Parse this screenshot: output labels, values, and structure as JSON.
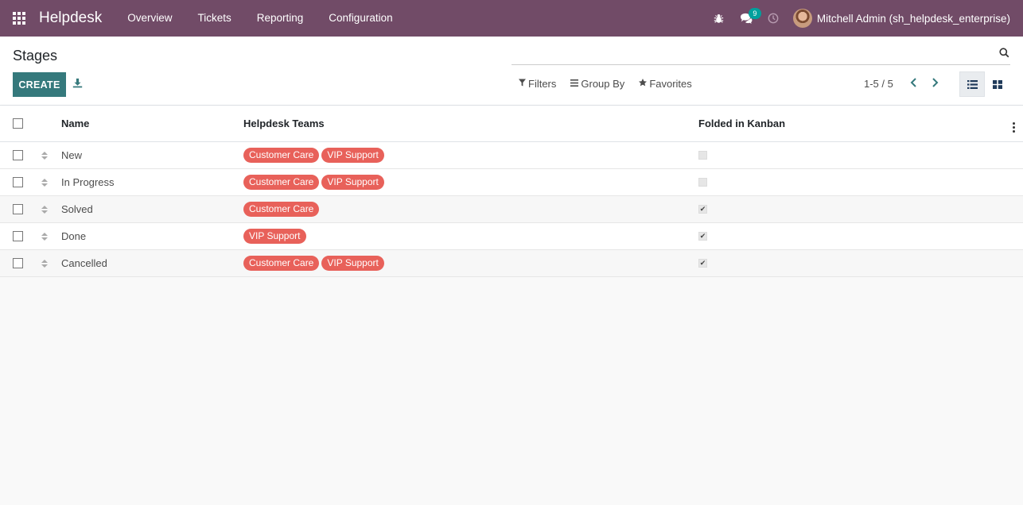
{
  "navbar": {
    "brand": "Helpdesk",
    "menu": [
      "Overview",
      "Tickets",
      "Reporting",
      "Configuration"
    ],
    "messages_count": "9",
    "user": "Mitchell Admin (sh_helpdesk_enterprise)"
  },
  "control_panel": {
    "title": "Stages",
    "search_placeholder": "",
    "create_label": "CREATE",
    "filters_label": "Filters",
    "groupby_label": "Group By",
    "favorites_label": "Favorites",
    "pager": "1-5 / 5"
  },
  "table": {
    "headers": {
      "name": "Name",
      "teams": "Helpdesk Teams",
      "folded": "Folded in Kanban"
    },
    "rows": [
      {
        "name": "New",
        "teams": [
          "Customer Care",
          "VIP Support"
        ],
        "folded": false
      },
      {
        "name": "In Progress",
        "teams": [
          "Customer Care",
          "VIP Support"
        ],
        "folded": false
      },
      {
        "name": "Solved",
        "teams": [
          "Customer Care"
        ],
        "folded": true
      },
      {
        "name": "Done",
        "teams": [
          "VIP Support"
        ],
        "folded": true
      },
      {
        "name": "Cancelled",
        "teams": [
          "Customer Care",
          "VIP Support"
        ],
        "folded": true
      }
    ]
  },
  "colors": {
    "navbar": "#714b67",
    "primary": "#35797c",
    "tag": "#e8615a",
    "badge": "#00a09d"
  }
}
